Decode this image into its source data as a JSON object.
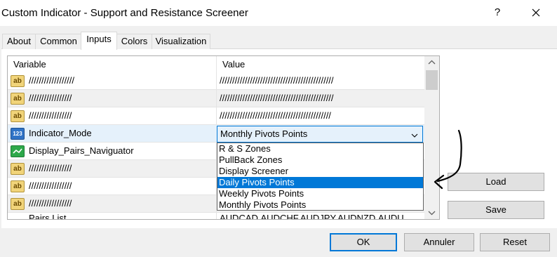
{
  "window": {
    "title": "Custom Indicator - Support and Resistance Screener",
    "help_label": "?"
  },
  "tabs": [
    {
      "label": "About",
      "active": false
    },
    {
      "label": "Common",
      "active": false
    },
    {
      "label": "Inputs",
      "active": true
    },
    {
      "label": "Colors",
      "active": false
    },
    {
      "label": "Visualization",
      "active": false
    }
  ],
  "grid": {
    "headers": {
      "variable": "Variable",
      "value": "Value"
    },
    "rows": [
      {
        "icon": "text-ab-icon",
        "variable": "//////////////////",
        "value": "/////////////////////////////////////////////"
      },
      {
        "icon": "text-ab-icon",
        "variable": "/////////////////",
        "value": "/////////////////////////////////////////////"
      },
      {
        "icon": "text-ab-icon",
        "variable": "/////////////////",
        "value": "////////////////////////////////////////////"
      },
      {
        "icon": "integer-123-icon",
        "variable": "Indicator_Mode",
        "value": "Monthly Pivots Points"
      },
      {
        "icon": "bool-icon",
        "variable": "Display_Pairs_Naviguator",
        "value": ""
      },
      {
        "icon": "text-ab-icon",
        "variable": "/////////////////",
        "value": ""
      },
      {
        "icon": "text-ab-icon",
        "variable": "/////////////////",
        "value": ""
      },
      {
        "icon": "text-ab-icon",
        "variable": "/////////////////",
        "value": ""
      }
    ],
    "partial_row": {
      "variable": "Pairs List",
      "value": "AUDCAD,AUDCHF,AUDJPY,AUDNZD,AUDU"
    }
  },
  "combo": {
    "selected": "Monthly Pivots Points",
    "options": [
      "R & S Zones",
      "PullBack Zones",
      "Display Screener",
      "Daily Pivots Points",
      "Weekly Pivots Points",
      "Monthly Pivots Points"
    ],
    "highlighted_index": 3
  },
  "buttons": {
    "load": "Load",
    "save": "Save",
    "ok": "OK",
    "cancel": "Annuler",
    "reset": "Reset"
  },
  "colors": {
    "accent": "#0078d7",
    "selected_row": "#e5f1fb"
  }
}
